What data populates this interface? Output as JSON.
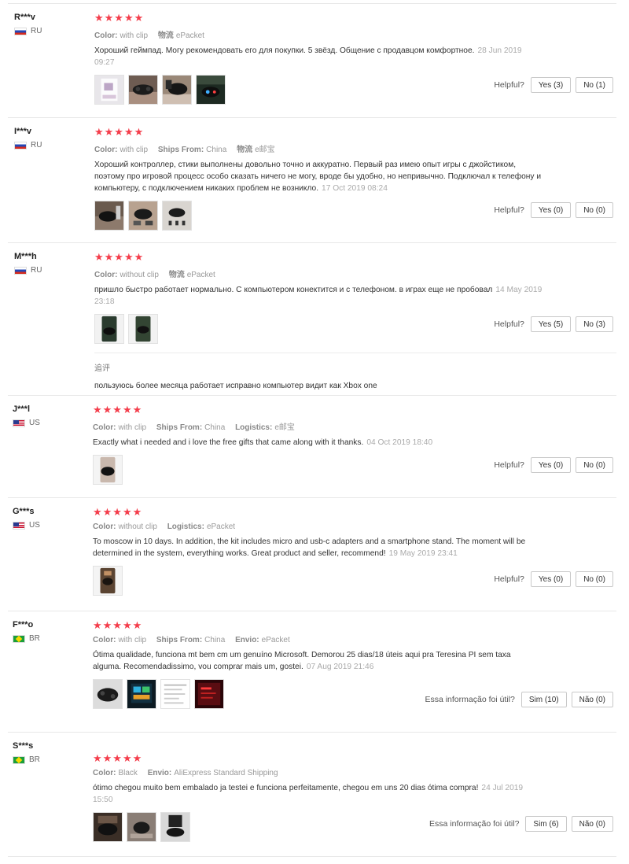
{
  "reviews": [
    {
      "user": "R***v",
      "country": "RU",
      "flag": "ru",
      "stars": "★★★★★",
      "attrs": [
        {
          "k": "Color:",
          "v": "with clip"
        },
        {
          "k": "物流",
          "v": "ePacket"
        }
      ],
      "text": "Хороший геймпад. Могу рекомендовать его для покупки. 5 звёзд. Общение с продавцом комфортное.",
      "date": "28 Jun 2019 09:27",
      "helpful_label": "Helpful?",
      "yes": "Yes (3)",
      "no": "No (1)",
      "photos": [
        "gamepad-photo",
        "gamepad-photo",
        "gamepad-photo",
        "gamepad-photo"
      ]
    },
    {
      "user": "I***v",
      "country": "RU",
      "flag": "ru",
      "stars": "★★★★★",
      "attrs": [
        {
          "k": "Color:",
          "v": "with clip"
        },
        {
          "k": "Ships From:",
          "v": "China"
        },
        {
          "k": "物流",
          "v": "e邮宝"
        }
      ],
      "text": "Хороший контроллер, стики выполнены довольно точно и аккуратно. Первый раз имею опыт игры с джойстиком, поэтому про игровой процесс особо сказать ничего не могу, вроде бы удобно, но непривычно. Подключал к телефону и компьютеру, с подключением никаких проблем не возникло.",
      "date": "17 Oct 2019 08:24",
      "helpful_label": "Helpful?",
      "yes": "Yes (0)",
      "no": "No (0)",
      "photos": [
        "gamepad-photo",
        "gamepad-photo",
        "gamepad-photo"
      ]
    },
    {
      "user": "M***h",
      "country": "RU",
      "flag": "ru",
      "stars": "★★★★★",
      "attrs": [
        {
          "k": "Color:",
          "v": "without clip"
        },
        {
          "k": "物流",
          "v": "ePacket"
        }
      ],
      "text": "пришло быстро работает нормально. С компьютером конектится и с телефоном. в играх еще не пробовал",
      "date": "14 May 2019 23:18",
      "helpful_label": "Helpful?",
      "yes": "Yes (5)",
      "no": "No (3)",
      "photos": [
        "gamepad-photo",
        "gamepad-photo"
      ],
      "followup": {
        "label": "追评",
        "text": "пользуюсь более месяца работает исправно компьютер видит как Xbox one"
      }
    },
    {
      "user": "J***l",
      "country": "US",
      "flag": "us",
      "stars": "★★★★★",
      "attrs": [
        {
          "k": "Color:",
          "v": "with clip"
        },
        {
          "k": "Ships From:",
          "v": "China"
        },
        {
          "k": "Logistics:",
          "v": "e邮宝"
        }
      ],
      "text": "Exactly what i needed and i love the free gifts that came along with it thanks.",
      "date": "04 Oct 2019 18:40",
      "helpful_label": "Helpful?",
      "yes": "Yes (0)",
      "no": "No (0)",
      "photos": [
        "gamepad-photo"
      ]
    },
    {
      "user": "G***s",
      "country": "US",
      "flag": "us",
      "stars": "★★★★★",
      "attrs": [
        {
          "k": "Color:",
          "v": "without clip"
        },
        {
          "k": "Logistics:",
          "v": "ePacket"
        }
      ],
      "text": "To moscow in 10 days. In addition, the kit includes micro and usb-c adapters and a smartphone stand. The moment will be determined in the system, everything works. Great product and seller, recommend!",
      "date": "19 May 2019 23:41",
      "helpful_label": "Helpful?",
      "yes": "Yes (0)",
      "no": "No (0)",
      "photos": [
        "gamepad-photo"
      ]
    },
    {
      "user": "F***o",
      "country": "BR",
      "flag": "br",
      "stars": "★★★★★",
      "attrs": [
        {
          "k": "Color:",
          "v": "with clip"
        },
        {
          "k": "Ships From:",
          "v": "China"
        },
        {
          "k": "Envio:",
          "v": "ePacket"
        }
      ],
      "text": "Ótima qualidade, funciona mt bem cm um genuíno Microsoft. Demorou 25 dias/18 úteis aqui pra Teresina PI sem taxa alguma. Recomendadissimo, vou comprar mais um, gostei.",
      "date": "07 Aug 2019 21:46",
      "helpful_label": "Essa informação foi útil?",
      "yes": "Sim (10)",
      "no": "Não (0)",
      "photos": [
        "gamepad-photo",
        "screenshot-photo",
        "document-photo",
        "screenshot-photo"
      ]
    },
    {
      "user": "S***s",
      "country": "BR",
      "flag": "br",
      "stars": "★★★★★",
      "attrs": [
        {
          "k": "Color:",
          "v": "Black"
        },
        {
          "k": "Envio:",
          "v": "AliExpress Standard Shipping"
        }
      ],
      "text": "ótimo chegou muito bem embalado ja testei e funciona perfeitamente, chegou em uns 20 dias ótima compra!",
      "date": "24 Jul 2019 15:50",
      "helpful_label": "Essa informação foi útil?",
      "yes": "Sim (6)",
      "no": "Não (0)",
      "photos": [
        "gamepad-photo",
        "gamepad-photo",
        "gamepad-photo"
      ]
    }
  ]
}
